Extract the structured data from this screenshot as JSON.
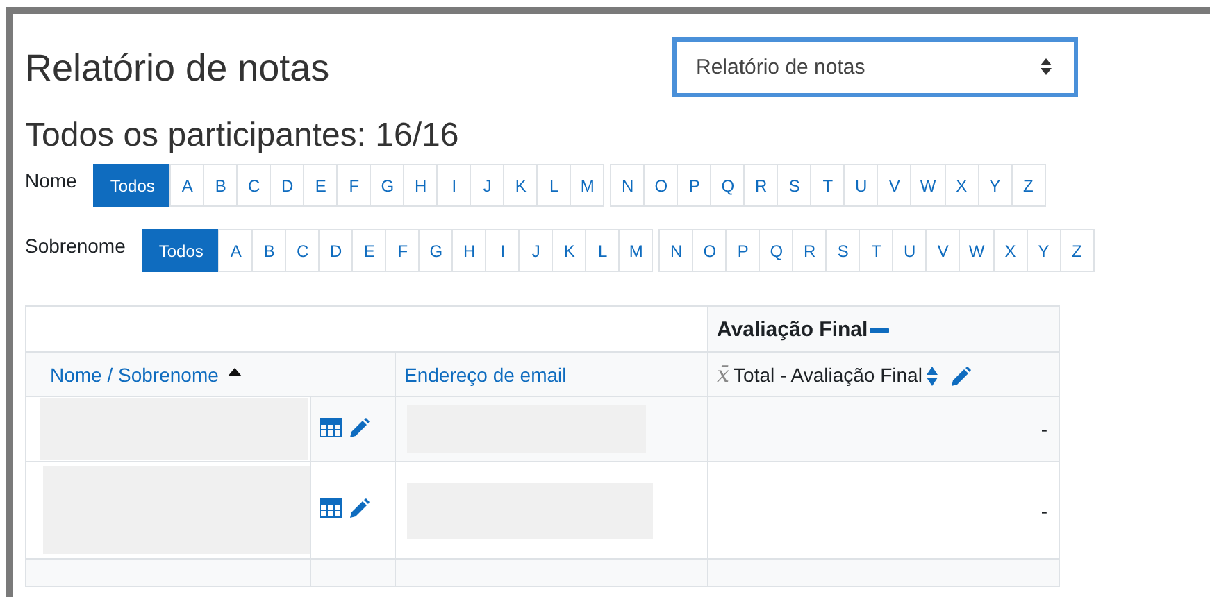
{
  "title": "Relatório de notas",
  "report_select": {
    "value": "Relatório de notas"
  },
  "subtitle": "Todos os participantes: 16/16",
  "filters": [
    {
      "label": "Nome",
      "buttons": [
        {
          "label": "Todos",
          "selected": true
        },
        {
          "label": "A",
          "selected": false
        },
        {
          "label": "B",
          "selected": false
        },
        {
          "label": "C",
          "selected": false
        },
        {
          "label": "D",
          "selected": false
        },
        {
          "label": "E",
          "selected": false
        },
        {
          "label": "F",
          "selected": false
        },
        {
          "label": "G",
          "selected": false
        },
        {
          "label": "H",
          "selected": false
        },
        {
          "label": "I",
          "selected": false
        },
        {
          "label": "J",
          "selected": false
        },
        {
          "label": "K",
          "selected": false
        },
        {
          "label": "L",
          "selected": false
        },
        {
          "label": "M",
          "selected": false
        },
        {
          "label": "N",
          "selected": false
        },
        {
          "label": "O",
          "selected": false
        },
        {
          "label": "P",
          "selected": false
        },
        {
          "label": "Q",
          "selected": false
        },
        {
          "label": "R",
          "selected": false
        },
        {
          "label": "S",
          "selected": false
        },
        {
          "label": "T",
          "selected": false
        },
        {
          "label": "U",
          "selected": false
        },
        {
          "label": "V",
          "selected": false
        },
        {
          "label": "W",
          "selected": false
        },
        {
          "label": "X",
          "selected": false
        },
        {
          "label": "Y",
          "selected": false
        },
        {
          "label": "Z",
          "selected": false
        }
      ]
    },
    {
      "label": "Sobrenome",
      "buttons": [
        {
          "label": "Todos",
          "selected": true
        },
        {
          "label": "A",
          "selected": false
        },
        {
          "label": "B",
          "selected": false
        },
        {
          "label": "C",
          "selected": false
        },
        {
          "label": "D",
          "selected": false
        },
        {
          "label": "E",
          "selected": false
        },
        {
          "label": "F",
          "selected": false
        },
        {
          "label": "G",
          "selected": false
        },
        {
          "label": "H",
          "selected": false
        },
        {
          "label": "I",
          "selected": false
        },
        {
          "label": "J",
          "selected": false
        },
        {
          "label": "K",
          "selected": false
        },
        {
          "label": "L",
          "selected": false
        },
        {
          "label": "M",
          "selected": false
        },
        {
          "label": "N",
          "selected": false
        },
        {
          "label": "O",
          "selected": false
        },
        {
          "label": "P",
          "selected": false
        },
        {
          "label": "Q",
          "selected": false
        },
        {
          "label": "R",
          "selected": false
        },
        {
          "label": "S",
          "selected": false
        },
        {
          "label": "T",
          "selected": false
        },
        {
          "label": "U",
          "selected": false
        },
        {
          "label": "V",
          "selected": false
        },
        {
          "label": "W",
          "selected": false
        },
        {
          "label": "X",
          "selected": false
        },
        {
          "label": "Y",
          "selected": false
        },
        {
          "label": "Z",
          "selected": false
        }
      ]
    }
  ],
  "table": {
    "category": "Avaliação Final",
    "columns": {
      "name": "Nome / Sobrenome",
      "email": "Endereço de email",
      "mean_symbol": "x̄",
      "grade_item": "Total - Avaliação Final"
    },
    "rows": [
      {
        "grade": "-"
      },
      {
        "grade": "-"
      }
    ]
  }
}
